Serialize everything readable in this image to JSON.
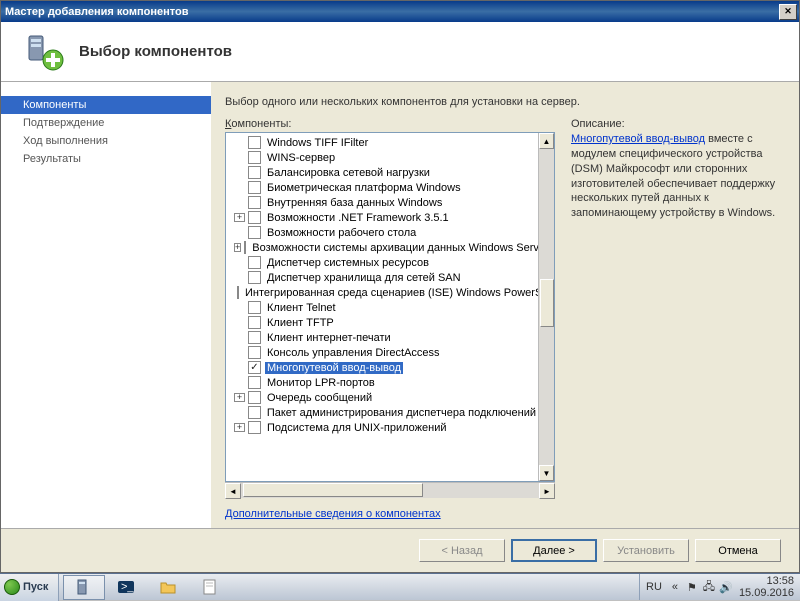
{
  "window": {
    "title": "Мастер добавления компонентов"
  },
  "header": {
    "title": "Выбор компонентов"
  },
  "sidebar": {
    "items": [
      {
        "label": "Компоненты",
        "active": true
      },
      {
        "label": "Подтверждение",
        "active": false
      },
      {
        "label": "Ход выполнения",
        "active": false
      },
      {
        "label": "Результаты",
        "active": false
      }
    ]
  },
  "content": {
    "instruction": "Выбор одного или нескольких компонентов для установки на сервер.",
    "components_label": "Компоненты:",
    "description_label": "Описание:",
    "more_link": "Дополнительные сведения о компонентах",
    "description_linktext": "Многопутевой ввод-вывод",
    "description_rest": " вместе с модулем специфического устройства (DSM) Майкрософт или сторонних изготовителей обеспечивает поддержку нескольких путей данных к запоминающему устройству в Windows."
  },
  "tree": [
    {
      "expand": "",
      "checked": false,
      "label": "Windows TIFF IFilter",
      "selected": false
    },
    {
      "expand": "",
      "checked": false,
      "label": "WINS-сервер",
      "selected": false
    },
    {
      "expand": "",
      "checked": false,
      "label": "Балансировка сетевой нагрузки",
      "selected": false
    },
    {
      "expand": "",
      "checked": false,
      "label": "Биометрическая платформа Windows",
      "selected": false
    },
    {
      "expand": "",
      "checked": false,
      "label": "Внутренняя база данных Windows",
      "selected": false
    },
    {
      "expand": "+",
      "checked": false,
      "label": "Возможности .NET Framework 3.5.1",
      "selected": false
    },
    {
      "expand": "",
      "checked": false,
      "label": "Возможности рабочего стола",
      "selected": false
    },
    {
      "expand": "+",
      "checked": false,
      "label": "Возможности системы архивации данных Windows Server",
      "selected": false
    },
    {
      "expand": "",
      "checked": false,
      "label": "Диспетчер системных ресурсов",
      "selected": false
    },
    {
      "expand": "",
      "checked": false,
      "label": "Диспетчер хранилища для сетей SAN",
      "selected": false
    },
    {
      "expand": "",
      "checked": false,
      "label": "Интегрированная среда сценариев (ISE) Windows PowerShell",
      "selected": false
    },
    {
      "expand": "",
      "checked": false,
      "label": "Клиент Telnet",
      "selected": false
    },
    {
      "expand": "",
      "checked": false,
      "label": "Клиент TFTP",
      "selected": false
    },
    {
      "expand": "",
      "checked": false,
      "label": "Клиент интернет-печати",
      "selected": false
    },
    {
      "expand": "",
      "checked": false,
      "label": "Консоль управления DirectAccess",
      "selected": false
    },
    {
      "expand": "",
      "checked": true,
      "label": "Многопутевой ввод-вывод",
      "selected": true
    },
    {
      "expand": "",
      "checked": false,
      "label": "Монитор LPR-портов",
      "selected": false
    },
    {
      "expand": "+",
      "checked": false,
      "label": "Очередь сообщений",
      "selected": false
    },
    {
      "expand": "",
      "checked": false,
      "label": "Пакет администрирования диспетчера подключений",
      "selected": false
    },
    {
      "expand": "+",
      "checked": false,
      "label": "Подсистема для UNIX-приложений",
      "selected": false
    }
  ],
  "buttons": {
    "back": "< Назад",
    "next": "Далее >",
    "install": "Установить",
    "cancel": "Отмена"
  },
  "taskbar": {
    "start": "Пуск",
    "lang": "RU",
    "time": "13:58",
    "date": "15.09.2016"
  }
}
